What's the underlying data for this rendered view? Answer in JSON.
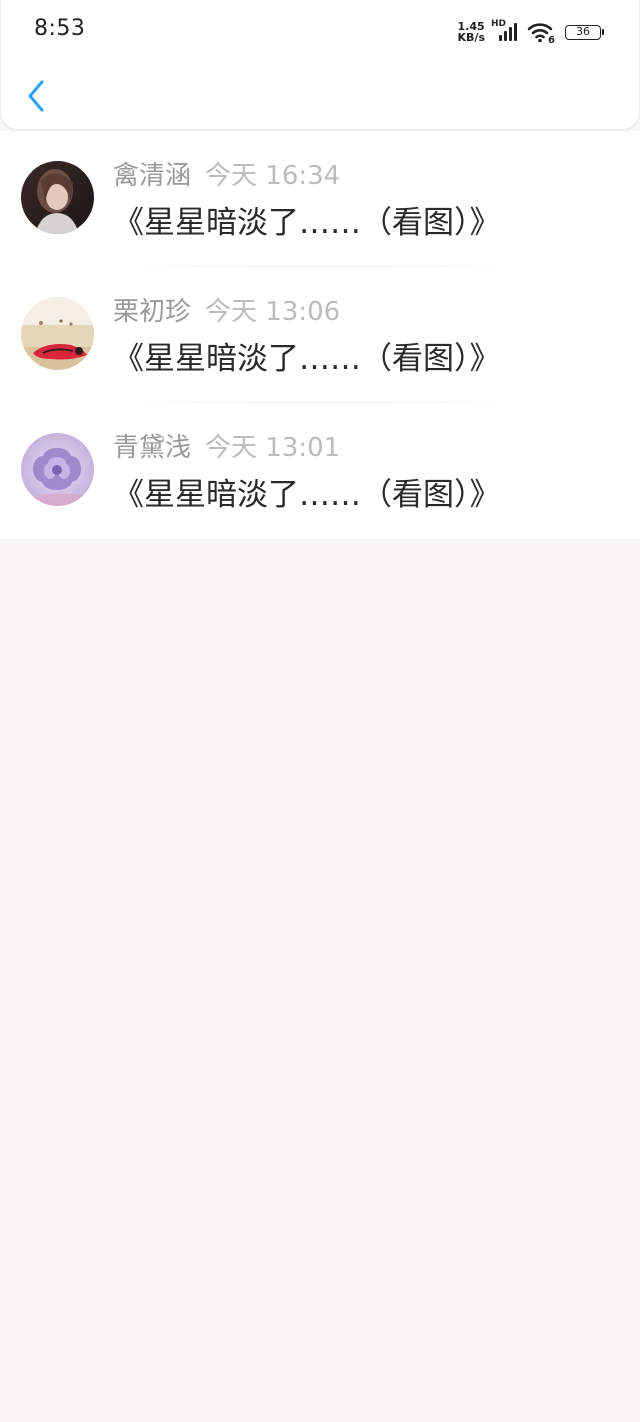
{
  "status_bar": {
    "time": "8:53",
    "net_speed_value": "1.45",
    "net_speed_unit": "KB/s",
    "signal_label": "HD",
    "wifi_label": "6",
    "battery": "36"
  },
  "nav": {
    "back_icon": "chevron-left-icon",
    "accent_color": "#2a9df4"
  },
  "messages": [
    {
      "name": "禽清涵",
      "time": "今天 16:34",
      "title": "《星星暗淡了……（看图）》"
    },
    {
      "name": "栗初珍",
      "time": "今天 13:06",
      "title": "《星星暗淡了……（看图）》"
    },
    {
      "name": "青黛浅",
      "time": "今天 13:01",
      "title": "《星星暗淡了……（看图）》"
    }
  ]
}
